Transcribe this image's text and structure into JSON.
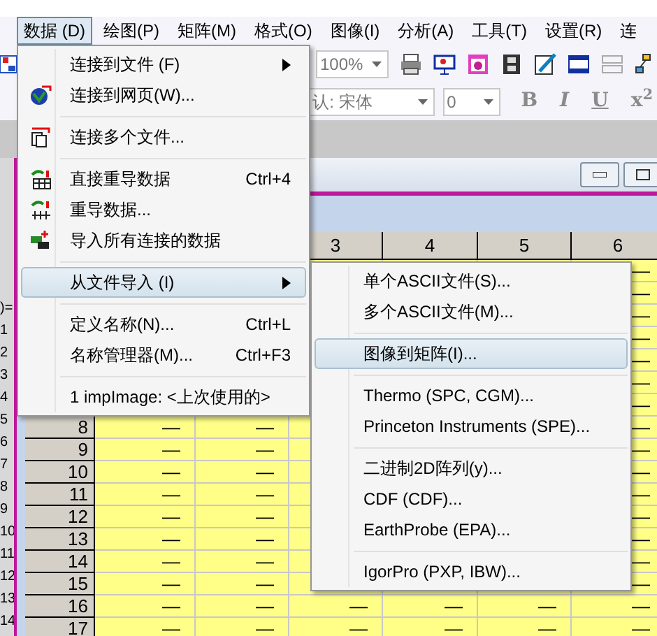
{
  "menubar": {
    "items": [
      {
        "label": "数据 (D)",
        "selected": true
      },
      {
        "label": "绘图(P)",
        "selected": false
      },
      {
        "label": "矩阵(M)",
        "selected": false
      },
      {
        "label": "格式(O)",
        "selected": false
      },
      {
        "label": "图像(I)",
        "selected": false
      },
      {
        "label": "分析(A)",
        "selected": false
      },
      {
        "label": "工具(T)",
        "selected": false
      },
      {
        "label": "设置(R)",
        "selected": false
      },
      {
        "label": "连",
        "selected": false
      }
    ]
  },
  "toolbar_1": {
    "zoom": "100%"
  },
  "toolbar_2": {
    "font": "认: 宋体",
    "font_size": "0",
    "format_buttons": [
      {
        "label": "B",
        "kind": "bold"
      },
      {
        "label": "I",
        "kind": "italic"
      },
      {
        "label": "U",
        "kind": "underline"
      },
      {
        "label": "x$^{2}$",
        "kind": "superscript"
      }
    ]
  },
  "data_menu": {
    "items": [
      {
        "kind": "item",
        "label": "连接到文件 (F)",
        "submenu": true,
        "icon": false,
        "selected": false
      },
      {
        "kind": "item",
        "label": "连接到网页(W)...",
        "submenu": false,
        "icon": true,
        "selected": false
      },
      {
        "kind": "separator"
      },
      {
        "kind": "item",
        "label": "连接多个文件...",
        "submenu": false,
        "icon": true,
        "selected": false
      },
      {
        "kind": "separator"
      },
      {
        "kind": "item",
        "label": "直接重导数据",
        "shortcut": "Ctrl+4",
        "submenu": false,
        "icon": true,
        "selected": false
      },
      {
        "kind": "item",
        "label": "重导数据...",
        "submenu": false,
        "icon": true,
        "selected": false
      },
      {
        "kind": "item",
        "label": "导入所有连接的数据",
        "submenu": false,
        "icon": true,
        "selected": false
      },
      {
        "kind": "separator"
      },
      {
        "kind": "item",
        "label": "从文件导入 (I)",
        "submenu": true,
        "icon": false,
        "selected": true
      },
      {
        "kind": "separator"
      },
      {
        "kind": "item",
        "label": "定义名称(N)...",
        "shortcut": "Ctrl+L",
        "submenu": false,
        "icon": false,
        "selected": false
      },
      {
        "kind": "item",
        "label": "名称管理器(M)...",
        "shortcut": "Ctrl+F3",
        "submenu": false,
        "icon": false,
        "selected": false
      },
      {
        "kind": "separator"
      },
      {
        "kind": "item",
        "label": "1 impImage: <上次使用的>",
        "submenu": false,
        "icon": false,
        "selected": false
      }
    ]
  },
  "import_submenu": {
    "items": [
      {
        "kind": "item",
        "label": "单个ASCII文件(S)...",
        "selected": false
      },
      {
        "kind": "item",
        "label": "多个ASCII文件(M)...",
        "selected": false
      },
      {
        "kind": "separator"
      },
      {
        "kind": "item",
        "label": "图像到矩阵(I)...",
        "selected": true
      },
      {
        "kind": "separator"
      },
      {
        "kind": "item",
        "label": "Thermo (SPC, CGM)...",
        "selected": false
      },
      {
        "kind": "item",
        "label": "Princeton Instruments (SPE)...",
        "selected": false
      },
      {
        "kind": "separator"
      },
      {
        "kind": "item",
        "label": "二进制2D阵列(y)...",
        "selected": false
      },
      {
        "kind": "item",
        "label": "CDF (CDF)...",
        "selected": false
      },
      {
        "kind": "item",
        "label": "EarthProbe (EPA)...",
        "selected": false
      },
      {
        "kind": "separator"
      },
      {
        "kind": "item",
        "label": "IgorPro (PXP, IBW)...",
        "selected": false
      }
    ]
  },
  "back_sheet": {
    "row_labels": [
      ")=",
      "1",
      "2",
      "3",
      "4",
      "5",
      "6",
      "7",
      "8",
      "9",
      "10",
      "11",
      "12",
      "13",
      "14"
    ]
  },
  "worksheet": {
    "columns": [
      null,
      null,
      "3",
      "4",
      "5",
      "6"
    ],
    "rows": [
      {
        "label": null,
        "cells": [
          null,
          null,
          null,
          null,
          null,
          "—"
        ]
      },
      {
        "label": null,
        "cells": [
          null,
          null,
          null,
          null,
          null,
          "—"
        ]
      },
      {
        "label": null,
        "cells": [
          null,
          null,
          null,
          null,
          null,
          "—"
        ]
      },
      {
        "label": null,
        "cells": [
          null,
          null,
          null,
          null,
          null,
          "—"
        ]
      },
      {
        "label": null,
        "cells": [
          null,
          null,
          null,
          null,
          null,
          "—"
        ]
      },
      {
        "label": null,
        "cells": [
          null,
          null,
          null,
          null,
          null,
          "—"
        ]
      },
      {
        "label": null,
        "cells": [
          null,
          null,
          null,
          null,
          null,
          "—"
        ]
      },
      {
        "label": "8",
        "cells": [
          "—",
          "—",
          null,
          null,
          null,
          "—"
        ]
      },
      {
        "label": "9",
        "cells": [
          "—",
          "—",
          null,
          null,
          null,
          "—"
        ]
      },
      {
        "label": "10",
        "cells": [
          "—",
          "—",
          null,
          null,
          null,
          "—"
        ]
      },
      {
        "label": "11",
        "cells": [
          "—",
          "—",
          null,
          null,
          null,
          "—"
        ]
      },
      {
        "label": "12",
        "cells": [
          "—",
          "—",
          null,
          null,
          null,
          "—"
        ]
      },
      {
        "label": "13",
        "cells": [
          "—",
          "—",
          null,
          null,
          null,
          "—"
        ]
      },
      {
        "label": "14",
        "cells": [
          "—",
          "—",
          null,
          null,
          null,
          "—"
        ]
      },
      {
        "label": "15",
        "cells": [
          "—",
          "—",
          null,
          null,
          null,
          "—"
        ]
      },
      {
        "label": "16",
        "cells": [
          "—",
          "—",
          "—",
          "—",
          "—",
          "—"
        ]
      },
      {
        "label": "17",
        "cells": [
          "—",
          "—",
          "—",
          "—",
          "—",
          "—"
        ]
      }
    ]
  }
}
